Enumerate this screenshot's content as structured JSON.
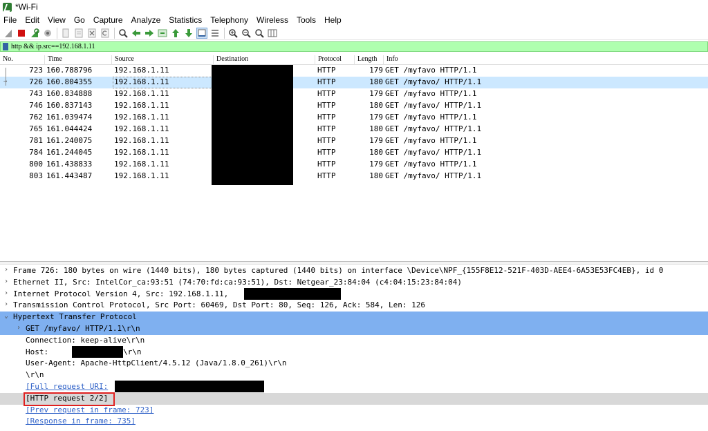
{
  "window": {
    "title": "*Wi-Fi"
  },
  "menu": [
    "File",
    "Edit",
    "View",
    "Go",
    "Capture",
    "Analyze",
    "Statistics",
    "Telephony",
    "Wireless",
    "Tools",
    "Help"
  ],
  "toolbar": {
    "icons": [
      "shark-fin-start-icon",
      "stop-capture-icon",
      "restart-capture-icon",
      "capture-options-icon",
      "open-file-icon",
      "save-file-icon",
      "close-file-icon",
      "reload-file-icon",
      "find-packet-icon",
      "go-back-icon",
      "go-forward-icon",
      "go-to-packet-icon",
      "go-first-icon",
      "go-last-icon",
      "autoscroll-icon",
      "colorize-icon",
      "zoom-in-icon",
      "zoom-out-icon",
      "normal-size-icon",
      "resize-columns-icon"
    ]
  },
  "filter": {
    "value": "http && ip.src==192.168.1.11"
  },
  "packet_list": {
    "columns": [
      "No.",
      "Time",
      "Source",
      "Destination",
      "Protocol",
      "Length",
      "Info"
    ],
    "rows": [
      {
        "no": "723",
        "time": "160.788796",
        "src": "192.168.1.11",
        "proto": "HTTP",
        "len": "179",
        "info": "GET /myfavo HTTP/1.1"
      },
      {
        "no": "726",
        "time": "160.804355",
        "src": "192.168.1.11",
        "proto": "HTTP",
        "len": "180",
        "info": "GET /myfavo/ HTTP/1.1"
      },
      {
        "no": "743",
        "time": "160.834888",
        "src": "192.168.1.11",
        "proto": "HTTP",
        "len": "179",
        "info": "GET /myfavo HTTP/1.1"
      },
      {
        "no": "746",
        "time": "160.837143",
        "src": "192.168.1.11",
        "proto": "HTTP",
        "len": "180",
        "info": "GET /myfavo/ HTTP/1.1"
      },
      {
        "no": "762",
        "time": "161.039474",
        "src": "192.168.1.11",
        "proto": "HTTP",
        "len": "179",
        "info": "GET /myfavo HTTP/1.1"
      },
      {
        "no": "765",
        "time": "161.044424",
        "src": "192.168.1.11",
        "proto": "HTTP",
        "len": "180",
        "info": "GET /myfavo/ HTTP/1.1"
      },
      {
        "no": "781",
        "time": "161.240075",
        "src": "192.168.1.11",
        "proto": "HTTP",
        "len": "179",
        "info": "GET /myfavo HTTP/1.1"
      },
      {
        "no": "784",
        "time": "161.244045",
        "src": "192.168.1.11",
        "proto": "HTTP",
        "len": "180",
        "info": "GET /myfavo/ HTTP/1.1"
      },
      {
        "no": "800",
        "time": "161.438833",
        "src": "192.168.1.11",
        "proto": "HTTP",
        "len": "179",
        "info": "GET /myfavo HTTP/1.1"
      },
      {
        "no": "803",
        "time": "161.443487",
        "src": "192.168.1.11",
        "proto": "HTTP",
        "len": "180",
        "info": "GET /myfavo/ HTTP/1.1"
      }
    ],
    "selected_index": 1
  },
  "details": [
    {
      "text": "Frame 726: 180 bytes on wire (1440 bits), 180 bytes captured (1440 bits) on interface \\Device\\NPF_{155F8E12-521F-403D-AEE4-6A53E53FC4EB}, id 0",
      "indent": 0,
      "arrow": "collapsed"
    },
    {
      "text": "Ethernet II, Src: IntelCor_ca:93:51 (74:70:fd:ca:93:51), Dst: Netgear_23:84:04 (c4:04:15:23:84:04)",
      "indent": 0,
      "arrow": "collapsed"
    },
    {
      "text": "Internet Protocol Version 4, Src: 192.168.1.11,",
      "indent": 0,
      "arrow": "collapsed"
    },
    {
      "text": "Transmission Control Protocol, Src Port: 60469, Dst Port: 80, Seq: 126, Ack: 584, Len: 126",
      "indent": 0,
      "arrow": "collapsed"
    },
    {
      "text": "Hypertext Transfer Protocol",
      "indent": 0,
      "arrow": "expanded",
      "highlight": "blue"
    },
    {
      "text": "GET /myfavo/ HTTP/1.1\\r\\n",
      "indent": 1,
      "arrow": "collapsed",
      "highlight": "blue"
    },
    {
      "text": "Connection: keep-alive\\r\\n",
      "indent": 1,
      "arrow": "none"
    },
    {
      "text": "Host:",
      "indent": 1,
      "arrow": "none",
      "suffix": "\\r\\n"
    },
    {
      "text": "User-Agent: Apache-HttpClient/4.5.12 (Java/1.8.0_261)\\r\\n",
      "indent": 1,
      "arrow": "none"
    },
    {
      "text": "\\r\\n",
      "indent": 1,
      "arrow": "none"
    },
    {
      "text": "[Full request URI:",
      "indent": 1,
      "arrow": "none",
      "link": true
    },
    {
      "text": "[HTTP request 2/2]",
      "indent": 1,
      "arrow": "none",
      "highlight": "gray"
    },
    {
      "text": "[Prev request in frame: 723]",
      "indent": 1,
      "arrow": "none",
      "link": true
    },
    {
      "text": "[Response in frame: 735]",
      "indent": 1,
      "arrow": "none",
      "link": true
    }
  ],
  "colors": {
    "filter_bg": "#afffaf",
    "selected_row": "#cce8ff",
    "detail_highlight": "#7fb0f0",
    "annotation": "#e02020"
  }
}
